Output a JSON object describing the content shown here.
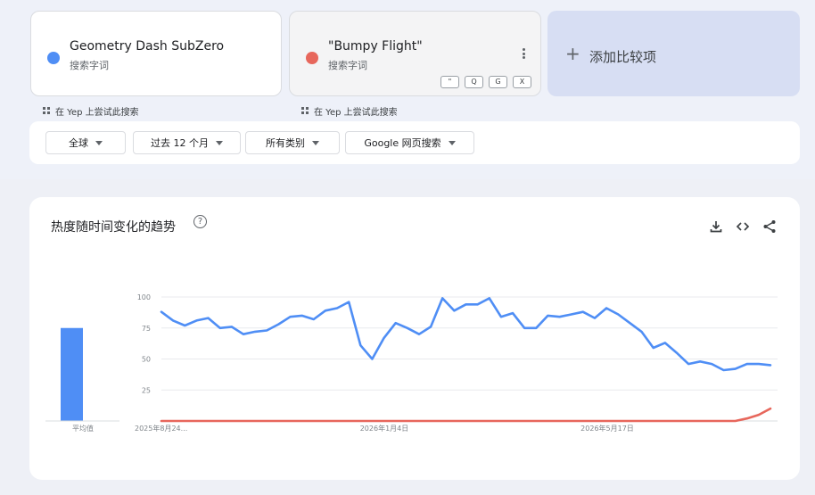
{
  "terms": [
    {
      "name": "Geometry Dash SubZero",
      "type": "搜索字词",
      "color": "#4f8ef5"
    },
    {
      "name": "\"Bumpy Flight\"",
      "type": "搜索字词",
      "color": "#e7675c"
    }
  ],
  "term_chips": [
    "\"",
    "Q",
    "G",
    "X"
  ],
  "add_compare": {
    "icon": "plus-icon",
    "label": "添加比较项"
  },
  "yep_hint": "在 Yep 上尝试此搜索",
  "filters": [
    {
      "label": "全球"
    },
    {
      "label": "过去 12 个月"
    },
    {
      "label": "所有类别"
    },
    {
      "label": "Google 网页搜索"
    }
  ],
  "panel": {
    "title": "热度随时间变化的趋势",
    "icons": [
      "help-icon",
      "download-icon",
      "embed-icon",
      "share-icon"
    ]
  },
  "colors": {
    "series1": "#4f8ef5",
    "series2": "#e7675c"
  },
  "chart_data": {
    "type": "line",
    "x_labels": [
      "2025年8月24...",
      "2026年1月4日",
      "2026年5月17日"
    ],
    "y_ticks": [
      25,
      50,
      75,
      100
    ],
    "ylim": [
      0,
      100
    ],
    "grid": true,
    "average": {
      "label": "平均值",
      "values": [
        75,
        0
      ]
    },
    "series": [
      {
        "name": "Geometry Dash SubZero",
        "values": [
          88,
          81,
          77,
          81,
          83,
          75,
          76,
          70,
          72,
          73,
          78,
          84,
          85,
          82,
          89,
          91,
          96,
          61,
          50,
          67,
          79,
          75,
          70,
          76,
          99,
          89,
          94,
          94,
          99,
          84,
          87,
          75,
          75,
          85,
          84,
          86,
          88,
          83,
          91,
          86,
          79,
          72,
          59,
          63,
          55,
          46,
          48,
          46,
          41,
          42,
          46,
          46,
          45
        ]
      },
      {
        "name": "\"Bumpy Flight\"",
        "values": [
          0,
          0,
          0,
          0,
          0,
          0,
          0,
          0,
          0,
          0,
          0,
          0,
          0,
          0,
          0,
          0,
          0,
          0,
          0,
          0,
          0,
          0,
          0,
          0,
          0,
          0,
          0,
          0,
          0,
          0,
          0,
          0,
          0,
          0,
          0,
          0,
          0,
          0,
          0,
          0,
          0,
          0,
          0,
          0,
          0,
          0,
          0,
          0,
          0,
          0,
          2,
          5,
          10
        ]
      }
    ]
  }
}
